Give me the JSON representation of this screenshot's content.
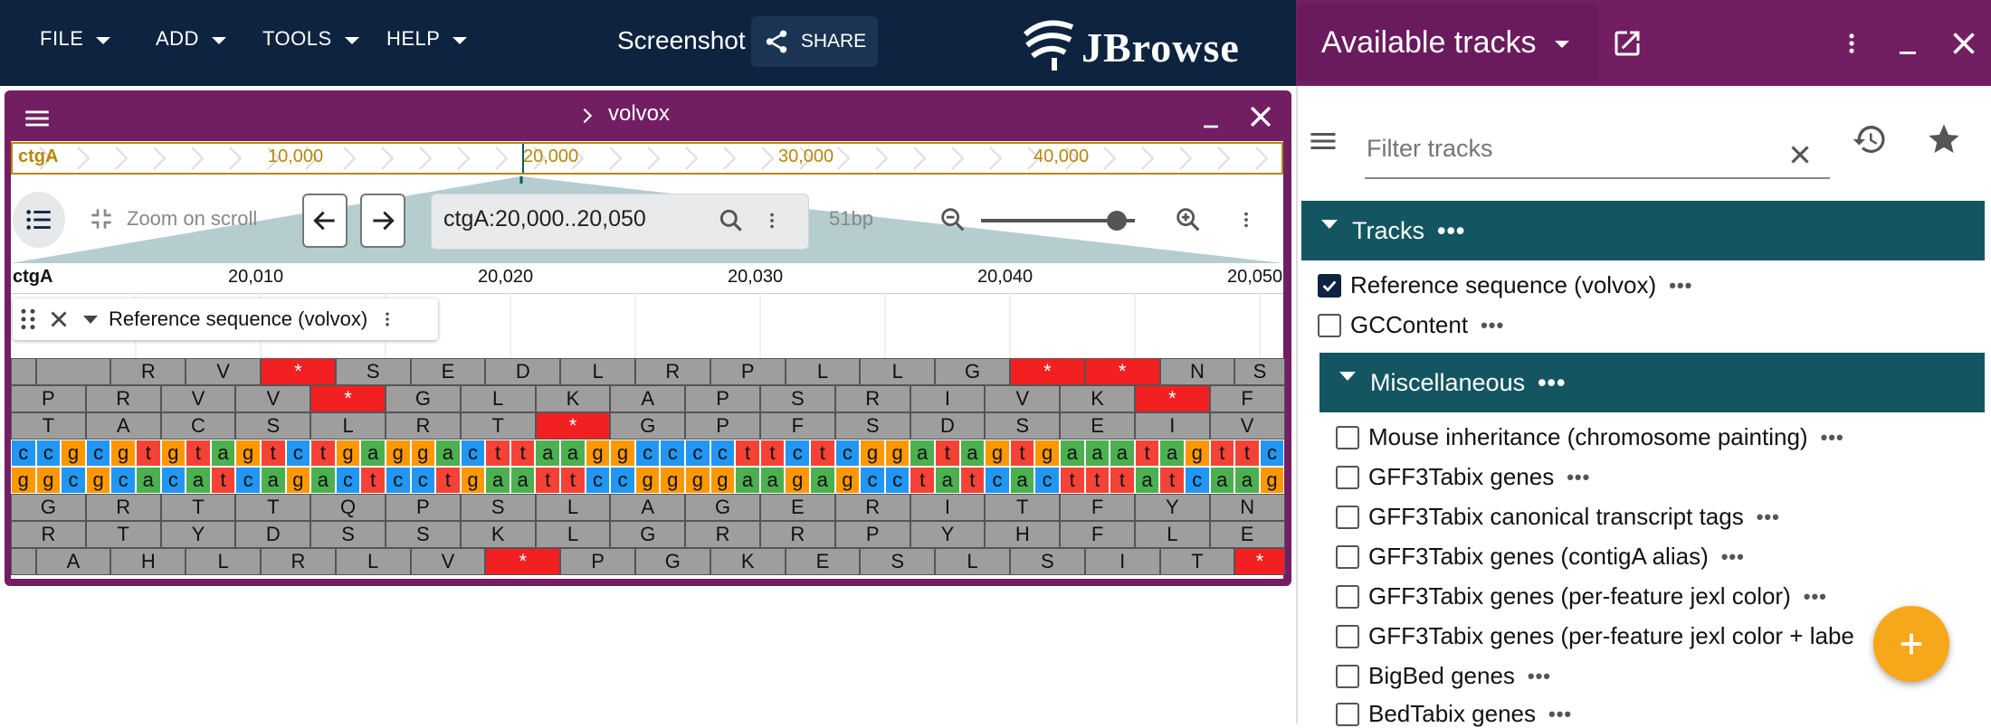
{
  "appbar": {
    "menus": [
      "FILE",
      "ADD",
      "TOOLS",
      "HELP"
    ],
    "title": "Screenshot",
    "share_label": "SHARE",
    "logo_text": "JBrowse"
  },
  "drawer": {
    "title": "Available tracks",
    "filter_placeholder": "Filter tracks",
    "sections": {
      "tracks_label": "Tracks",
      "misc_label": "Miscellaneous"
    },
    "tracks": [
      {
        "label": "Reference sequence (volvox)",
        "checked": true
      },
      {
        "label": "GCContent",
        "checked": false
      }
    ],
    "misc_tracks": [
      {
        "label": "Mouse inheritance (chromosome painting)",
        "checked": false
      },
      {
        "label": "GFF3Tabix genes",
        "checked": false
      },
      {
        "label": "GFF3Tabix canonical transcript tags",
        "checked": false
      },
      {
        "label": "GFF3Tabix genes (contigA alias)",
        "checked": false
      },
      {
        "label": "GFF3Tabix genes (per-feature jexl color)",
        "checked": false
      },
      {
        "label": "GFF3Tabix genes (per-feature jexl color + labe",
        "checked": false
      },
      {
        "label": "BigBed genes",
        "checked": false
      },
      {
        "label": "BedTabix genes",
        "checked": false
      }
    ]
  },
  "view": {
    "name": "volvox",
    "overview": {
      "contig": "ctgA",
      "labels": [
        "10,000",
        "20,000",
        "30,000",
        "40,000"
      ]
    },
    "zoom_toggle_label": "Zoom on scroll",
    "location": "ctgA:20,000..20,050",
    "bp_label": "51bp",
    "zoom_level": 0.88,
    "scale": {
      "contig": "ctgA",
      "labels": [
        "20,010",
        "20,020",
        "20,030",
        "20,040",
        "20,050"
      ]
    },
    "track_label": "Reference sequence (volvox)",
    "sequence": {
      "fwd": "ccgcgtgtagtctgaggacttaaggccccttctcggatagtgaaatagttc",
      "rev": "ggcgcacatcagactcctgaattccggggaagagcctatcactttatcaag",
      "frames": [
        " RV*SEDLRPLLG**NS",
        "PRVV*GLKAPSRIVK*F",
        "TACSLRT*GPFSDSEIV",
        "GRTTQPSLAGERITFYN",
        "RTYDSSKLGRRPYHFLE",
        "AHLRLV*PGKESLSIT*"
      ]
    }
  },
  "colors": {
    "appbar": "#0d233f",
    "drawer": "#721e63",
    "section": "#135560",
    "stop": "#f22020",
    "a": "#4caf50",
    "c": "#2196f3",
    "g": "#ff9800",
    "t": "#f44336"
  }
}
